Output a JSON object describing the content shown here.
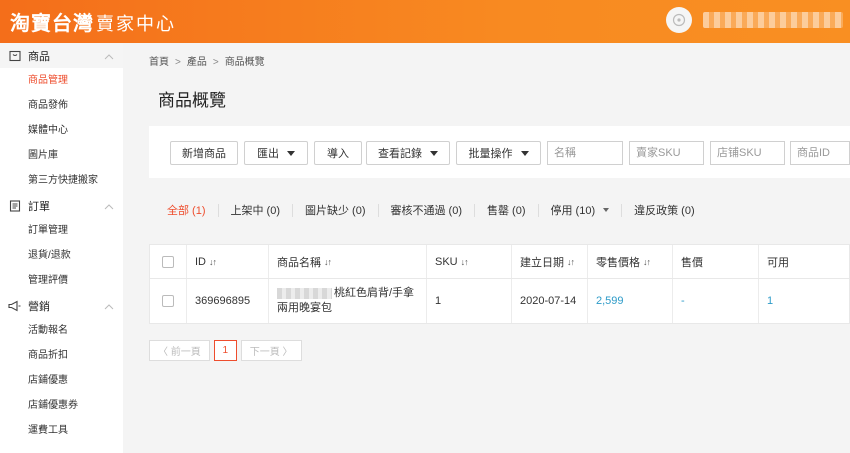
{
  "brand": {
    "name": "淘寶台灣",
    "subtitle": "賣家中心"
  },
  "sidebar": {
    "sections": [
      {
        "title": "商品",
        "icon": "box-icon",
        "items": [
          "商品管理",
          "商品發佈",
          "媒體中心",
          "圖片庫",
          "第三方快捷搬家"
        ]
      },
      {
        "title": "訂單",
        "icon": "clipboard-icon",
        "items": [
          "訂單管理",
          "退貨/退款",
          "管理評價"
        ]
      },
      {
        "title": "營銷",
        "icon": "megaphone-icon",
        "items": [
          "活動報名",
          "商品折扣",
          "店鋪優惠",
          "店鋪優惠券",
          "運費工具"
        ]
      }
    ]
  },
  "breadcrumb": [
    "首頁",
    "產品",
    "商品概覽"
  ],
  "page_title": "商品概覽",
  "toolbar": {
    "add": "新增商品",
    "export": "匯出",
    "import": "導入",
    "history": "查看記錄",
    "bulk": "批量操作",
    "placeholders": {
      "name": "名稱",
      "seller_sku": "賣家SKU",
      "store_sku": "店铺SKU",
      "product_id": "商品ID"
    }
  },
  "filter_tabs": [
    {
      "label": "全部 (1)",
      "active": true
    },
    {
      "label": "上架中 (0)"
    },
    {
      "label": "圖片缺少 (0)"
    },
    {
      "label": "審核不通過 (0)"
    },
    {
      "label": "售罄 (0)"
    },
    {
      "label": "停用 (10)",
      "dropdown": true
    },
    {
      "label": "違反政策 (0)"
    }
  ],
  "table": {
    "headers": {
      "id": "ID",
      "name": "商品名稱",
      "sku": "SKU",
      "created": "建立日期",
      "price": "零售價格",
      "sale": "售價",
      "available": "可用"
    },
    "rows": [
      {
        "id": "369696895",
        "name_line1": "桃紅色肩背/手拿",
        "name_line2": "兩用晚宴包",
        "sku": "1",
        "created": "2020-07-14",
        "price": "2,599",
        "sale": "-",
        "available": "1"
      }
    ]
  },
  "pager": {
    "prev": "〈 前一頁",
    "page": "1",
    "next": "下一頁 〉"
  },
  "colors": {
    "brand": "#f46e1a",
    "accent": "#ee4d2d",
    "link": "#2d9bc8"
  }
}
